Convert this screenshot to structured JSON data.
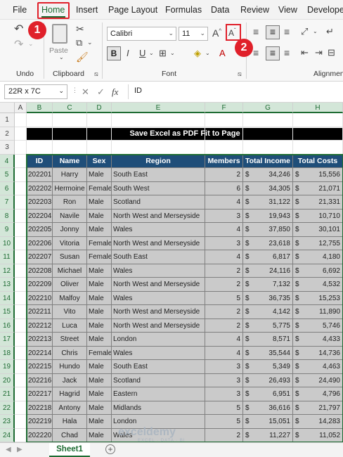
{
  "menu": {
    "items": [
      "File",
      "Home",
      "Insert",
      "Page Layout",
      "Formulas",
      "Data",
      "Review",
      "View",
      "Developer"
    ],
    "active": "Home"
  },
  "ribbon": {
    "undo_label": "Undo",
    "clipboard_label": "Clipboard",
    "paste_label": "Paste",
    "font_label": "Font",
    "alignment_label": "Alignment",
    "font_name": "Calibri",
    "font_size": "11",
    "bold": "B",
    "italic": "I",
    "underline": "U",
    "grow_font": "A",
    "shrink_font": "A"
  },
  "badges": {
    "one": "1",
    "two": "2"
  },
  "formula_bar": {
    "name_box": "22R x 7C",
    "fx": "fx",
    "content": "ID"
  },
  "columns": [
    "A",
    "B",
    "C",
    "D",
    "E",
    "F",
    "G",
    "H"
  ],
  "rows": [
    "1",
    "2",
    "3",
    "4",
    "5",
    "6",
    "7",
    "8",
    "9",
    "10",
    "11",
    "12",
    "13",
    "14",
    "15",
    "16",
    "17",
    "18",
    "19",
    "20",
    "21",
    "22",
    "23",
    "24"
  ],
  "sheet": {
    "title": "Save Excel as PDF Fit to Page",
    "headers": [
      "ID",
      "Name",
      "Sex",
      "Region",
      "Members",
      "Total Income",
      "Total Costs"
    ],
    "currency": "$",
    "rows": [
      [
        "202201",
        "Harry",
        "Male",
        "South East",
        "2",
        "34,246",
        "15,556"
      ],
      [
        "202202",
        "Hermoine",
        "Female",
        "South West",
        "6",
        "34,305",
        "21,071"
      ],
      [
        "202203",
        "Ron",
        "Male",
        "Scotland",
        "4",
        "31,122",
        "21,331"
      ],
      [
        "202204",
        "Navile",
        "Male",
        "North West and Merseyside",
        "3",
        "19,943",
        "10,710"
      ],
      [
        "202205",
        "Jonny",
        "Male",
        "Wales",
        "4",
        "37,850",
        "30,101"
      ],
      [
        "202206",
        "Vitoria",
        "Female",
        "North West and Merseyside",
        "3",
        "23,618",
        "12,755"
      ],
      [
        "202207",
        "Susan",
        "Female",
        "South East",
        "4",
        "6,817",
        "4,180"
      ],
      [
        "202208",
        "Michael",
        "Male",
        "Wales",
        "2",
        "24,116",
        "6,692"
      ],
      [
        "202209",
        "Oliver",
        "Male",
        "North West and Merseyside",
        "2",
        "7,132",
        "4,532"
      ],
      [
        "202210",
        "Malfoy",
        "Male",
        "Wales",
        "5",
        "36,735",
        "15,253"
      ],
      [
        "202211",
        "Vito",
        "Male",
        "North West and Merseyside",
        "2",
        "4,142",
        "11,890"
      ],
      [
        "202212",
        "Luca",
        "Male",
        "North West and Merseyside",
        "2",
        "5,775",
        "5,746"
      ],
      [
        "202213",
        "Street",
        "Male",
        "London",
        "4",
        "8,571",
        "4,433"
      ],
      [
        "202214",
        "Chris",
        "Female",
        "Wales",
        "4",
        "35,544",
        "14,736"
      ],
      [
        "202215",
        "Hundo",
        "Male",
        "South East",
        "3",
        "5,349",
        "4,463"
      ],
      [
        "202216",
        "Jack",
        "Male",
        "Scotland",
        "3",
        "26,493",
        "24,490"
      ],
      [
        "202217",
        "Hagrid",
        "Male",
        "Eastern",
        "3",
        "6,951",
        "4,796"
      ],
      [
        "202218",
        "Antony",
        "Male",
        "Midlands",
        "5",
        "36,616",
        "21,797"
      ],
      [
        "202219",
        "Hala",
        "Male",
        "London",
        "5",
        "15,051",
        "14,283"
      ],
      [
        "202220",
        "Chad",
        "Male",
        "Wales",
        "2",
        "11,227",
        "11,052"
      ]
    ]
  },
  "sheet_tab": "Sheet1",
  "watermark": {
    "brand": "exceldemy",
    "tagline": "EXCEL · DATA · BI"
  },
  "colors": {
    "accent": "#1e6c33",
    "header_fill": "#1f4e79",
    "highlight": "#e0202a"
  }
}
